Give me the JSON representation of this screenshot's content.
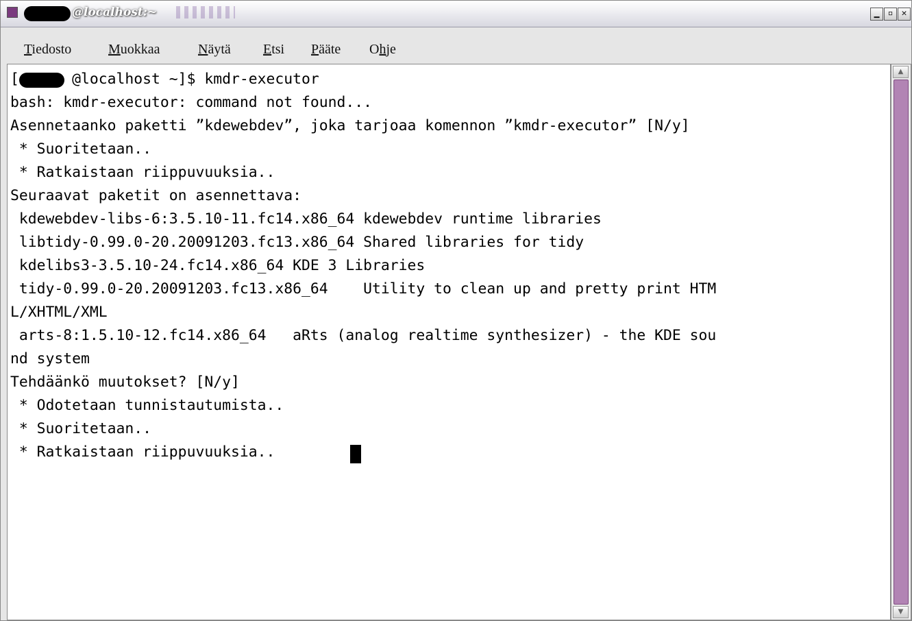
{
  "window": {
    "title": "@localhost:~",
    "buttons": {
      "minimize": "▁",
      "maximize": "▫",
      "close": "✕"
    }
  },
  "menu": {
    "items": [
      {
        "mnemonic": "T",
        "rest": "iedosto"
      },
      {
        "mnemonic": "M",
        "rest": "uokkaa"
      },
      {
        "mnemonic": "N",
        "rest": "äytä"
      },
      {
        "mnemonic": "E",
        "rest": "tsi"
      },
      {
        "mnemonic": "P",
        "rest": "ääte"
      },
      {
        "pre": "O",
        "mnemonic": "h",
        "rest": "je"
      }
    ]
  },
  "terminal": {
    "lines": [
      "[      @localhost ~]$ kmdr-executor",
      "bash: kmdr-executor: command not found...",
      "Asennetaanko paketti ”kdewebdev”, joka tarjoaa komennon ”kmdr-executor” [N/y]",
      " * Suoritetaan..",
      " * Ratkaistaan riippuvuuksia..",
      "Seuraavat paketit on asennettava:",
      " kdewebdev-libs-6:3.5.10-11.fc14.x86_64 kdewebdev runtime libraries",
      " libtidy-0.99.0-20.20091203.fc13.x86_64 Shared libraries for tidy",
      " kdelibs3-3.5.10-24.fc14.x86_64 KDE 3 Libraries",
      " tidy-0.99.0-20.20091203.fc13.x86_64    Utility to clean up and pretty print HTM",
      "L/XHTML/XML",
      " arts-8:1.5.10-12.fc14.x86_64   aRts (analog realtime synthesizer) - the KDE sou",
      "nd system",
      "Tehdäänkö muutokset? [N/y]",
      " * Odotetaan tunnistautumista..",
      " * Suoritetaan..",
      " * Ratkaistaan riippuvuuksia.."
    ]
  },
  "scrollbar": {
    "up_icon": "▲",
    "down_icon": "▼",
    "thumb_color": "#b284b4"
  }
}
